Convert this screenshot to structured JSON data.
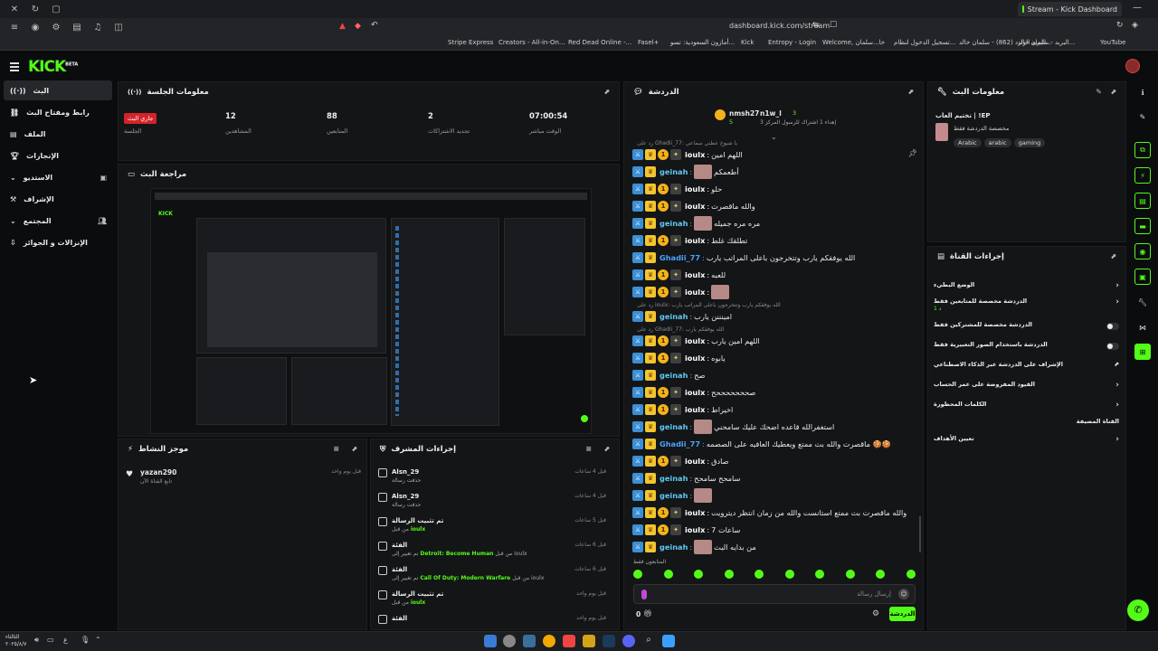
{
  "browser": {
    "tab_title": "Stream - Kick Dashboard",
    "url": "dashboard.kick.com/stream",
    "bookmarks": [
      "Stripe Express",
      "Creators - All-in-On...",
      "Red Dead Online -...",
      "Fasel+",
      "أمازون السعودية: تسو...",
      "Kick",
      "Entropy - Login",
      "Welcome, خا...سلمان",
      "تسجيل الدخول لنظام...",
      "البريد الوارد (862) - سلمان خالد...",
      "البريد - سلمان خالد...",
      "YouTube"
    ]
  },
  "app": {
    "logo": "KICK",
    "logo_badge": "BETA"
  },
  "sidebar": {
    "items": [
      {
        "label": "البث",
        "icon": "broadcast-icon"
      },
      {
        "label": "رابط ومفتاح البث",
        "icon": "link-icon"
      },
      {
        "label": "الملف",
        "icon": "file-icon"
      },
      {
        "label": "الإنجازات",
        "icon": "trophy-icon"
      },
      {
        "label": "الاستديو",
        "icon": "studio-icon"
      },
      {
        "label": "الإشراف",
        "icon": "moderation-icon"
      },
      {
        "label": "المجتمع",
        "icon": "community-icon"
      },
      {
        "label": "الإنزالات و الجوائز",
        "icon": "drops-icon"
      }
    ]
  },
  "session": {
    "title": "معلومات الجلسة",
    "live_badge": "جاري البث",
    "stats": [
      {
        "value": "07:00:54",
        "label": "الوقت مباشر"
      },
      {
        "value": "2",
        "label": "تجديد الاشتراكات"
      },
      {
        "value": "88",
        "label": "المتابعين"
      },
      {
        "value": "12",
        "label": "المشاهدين"
      },
      {
        "value": "",
        "label": "الجلسة"
      }
    ]
  },
  "preview": {
    "title": "مراجعة البث"
  },
  "activity": {
    "title": "موجز النشاط",
    "items": [
      {
        "user": "yazan290",
        "text": "تابع القناة الآن",
        "time": "قبل يوم واحد"
      }
    ]
  },
  "mod_actions": {
    "title": "إجراءات المشرف",
    "items": [
      {
        "title": "Alsn_29",
        "detail": "حذفت رسالة",
        "time": "قبل 4 ساعات",
        "icon": "trash-icon"
      },
      {
        "title": "Alsn_29",
        "detail": "حذفت رسالة",
        "time": "قبل 4 ساعات",
        "icon": "trash-icon"
      },
      {
        "title": "تم تثبيت الرسالة",
        "detail_prefix": "من قبل",
        "highlight": "ioulx",
        "time": "قبل 5 ساعات",
        "icon": "pin-icon"
      },
      {
        "title": "الفئة",
        "detail_prefix": "تم تغيير إلى",
        "highlight": "Detroit: Become Human",
        "suffix": "من قبل ioulx",
        "time": "قبل 6 ساعات",
        "icon": "category-icon"
      },
      {
        "title": "الفئة",
        "detail_prefix": "تم تغيير إلى",
        "highlight": "Call Of Duty: Modern Warfare",
        "suffix": "من قبل ioulx",
        "time": "قبل 6 ساعات",
        "icon": "category-icon"
      },
      {
        "title": "تم تثبيت الرسالة",
        "detail_prefix": "من قبل",
        "highlight": "ioulx",
        "time": "قبل يوم واحد",
        "icon": "pin-icon"
      },
      {
        "title": "الفئة",
        "detail_prefix": "",
        "highlight": "",
        "time": "قبل يوم واحد",
        "icon": "category-icon"
      }
    ]
  },
  "chat": {
    "title": "الدردشة",
    "top_users": [
      {
        "name": "nmsh27",
        "count": "5"
      },
      {
        "name": "n1w_l",
        "count": "3"
      }
    ],
    "top_note": "إهداء 1 اشتراك للرسول المركز 3",
    "pinned_reply": "رد على Ghadii_77: يا شيوخ عطني سماعي",
    "messages": [
      {
        "user": "ioulx",
        "color": "#ffffff",
        "text": "اللهم امين",
        "badges": [
          "mod",
          "vip",
          "sub",
          "og"
        ]
      },
      {
        "user": "geinah",
        "color": "#5ec8f2",
        "text": "أطعمكم",
        "badges": [
          "mod",
          "vip"
        ],
        "thumb": true
      },
      {
        "user": "ioulx",
        "color": "#ffffff",
        "text": "حلو",
        "badges": [
          "mod",
          "vip",
          "sub",
          "og"
        ]
      },
      {
        "user": "ioulx",
        "color": "#ffffff",
        "text": "والله ماقصرت",
        "badges": [
          "mod",
          "vip",
          "sub",
          "og"
        ]
      },
      {
        "user": "geinah",
        "color": "#5ec8f2",
        "text": "مره مره جميله",
        "badges": [
          "mod",
          "vip"
        ],
        "thumb": true
      },
      {
        "user": "ioulx",
        "color": "#ffffff",
        "text": "تطلقك غلط",
        "badges": [
          "mod",
          "vip",
          "sub",
          "og"
        ]
      },
      {
        "user": "Ghadii_77",
        "color": "#4aa3ff",
        "text": "الله يوفقكم يارب وتتخرجون باعلى المراتب يارب",
        "badges": [
          "mod",
          "vip"
        ]
      },
      {
        "user": "ioulx",
        "color": "#ffffff",
        "text": "للعبه",
        "badges": [
          "mod",
          "vip",
          "sub",
          "og"
        ]
      },
      {
        "user": "ioulx",
        "color": "#ffffff",
        "text": "",
        "badges": [
          "mod",
          "vip",
          "sub",
          "og"
        ],
        "thumb": true
      },
      {
        "user": "geinah",
        "color": "#5ec8f2",
        "text": "امينننن يارب",
        "badges": [
          "mod",
          "vip"
        ],
        "reply": "رد على ioulx: الله يوفقكم يارب وتتخرجون باعلى المراتب يارب"
      },
      {
        "user": "ioulx",
        "color": "#ffffff",
        "text": "اللهم امين يارب",
        "badges": [
          "mod",
          "vip",
          "sub",
          "og"
        ],
        "reply": "رد على Ghadii_77: الله يوفقكم يارب"
      },
      {
        "user": "ioulx",
        "color": "#ffffff",
        "text": "يابوه",
        "badges": [
          "mod",
          "vip",
          "sub",
          "og"
        ]
      },
      {
        "user": "geinah",
        "color": "#5ec8f2",
        "text": "صح",
        "badges": [
          "mod",
          "vip"
        ]
      },
      {
        "user": "ioulx",
        "color": "#ffffff",
        "text": "صحححححححح",
        "badges": [
          "mod",
          "vip",
          "sub",
          "og"
        ]
      },
      {
        "user": "ioulx",
        "color": "#ffffff",
        "text": "اخيراط",
        "badges": [
          "mod",
          "vip",
          "sub",
          "og"
        ]
      },
      {
        "user": "geinah",
        "color": "#5ec8f2",
        "text": "استغفرالله قاعده اضحك عليك سامحني",
        "badges": [
          "mod",
          "vip"
        ],
        "thumb": true
      },
      {
        "user": "Ghadii_77",
        "color": "#4aa3ff",
        "text": "ماقصرت والله بث ممتع ويعطيك العافيه على الصصمه 🍪🍪",
        "badges": [
          "mod",
          "vip"
        ]
      },
      {
        "user": "ioulx",
        "color": "#ffffff",
        "text": "صادق",
        "badges": [
          "mod",
          "vip",
          "sub",
          "og"
        ]
      },
      {
        "user": "geinah",
        "color": "#5ec8f2",
        "text": "سامحح سامحح",
        "badges": [
          "mod",
          "vip"
        ]
      },
      {
        "user": "geinah",
        "color": "#5ec8f2",
        "text": "",
        "badges": [
          "mod",
          "vip"
        ],
        "thumb": true
      },
      {
        "user": "ioulx",
        "color": "#ffffff",
        "text": "والله ماقصرت بث ممتع استانست والله من زمان انتظر ديترويت",
        "badges": [
          "mod",
          "vip",
          "sub",
          "og"
        ]
      },
      {
        "user": "ioulx",
        "color": "#ffffff",
        "text": "7 ساعات",
        "badges": [
          "mod",
          "vip",
          "sub",
          "og"
        ]
      },
      {
        "user": "geinah",
        "color": "#5ec8f2",
        "text": "من بدايه البث",
        "badges": [
          "mod",
          "vip"
        ],
        "thumb": true
      }
    ],
    "followers_only": "المتابعون فقط",
    "input_placeholder": "إرسال رسالة",
    "send_label": "الدردشة",
    "viewer_count": "0"
  },
  "stream_info": {
    "title": "معلومات البث",
    "stream_title": "تختيم العاب | !EP",
    "category": "مخصصة الدردشة فقط",
    "tags": [
      "Arabic",
      "arabic",
      "gaming"
    ]
  },
  "channel_actions": {
    "title": "إجراءات القناة",
    "rows": [
      {
        "label": "الوضع البطيء",
        "control": "arrow"
      },
      {
        "label": "الدردشة مخصصة للمتابعين فقط",
        "sub": "1 د",
        "control": "arrow"
      },
      {
        "label": "الدردشة مخصصة للمشتركين فقط",
        "control": "toggle"
      },
      {
        "label": "الدردشة باستخدام الصور التعبيرية فقط",
        "control": "toggle"
      },
      {
        "label": "الإشراف على الدردشة عبر الذكاء الاصطناعي",
        "control": "external"
      },
      {
        "label": "القيود المفروضة على عمر الحساب",
        "control": "arrow"
      },
      {
        "label": "الكلمات المحظورة",
        "control": "arrow"
      },
      {
        "label": "القناة المضيفة",
        "control": "none"
      },
      {
        "label": "تعيين الأهداف",
        "control": "arrow"
      }
    ]
  },
  "taskbar": {
    "time": "الثالثاء",
    "date": "٢٠٢٥/٨/٧"
  }
}
